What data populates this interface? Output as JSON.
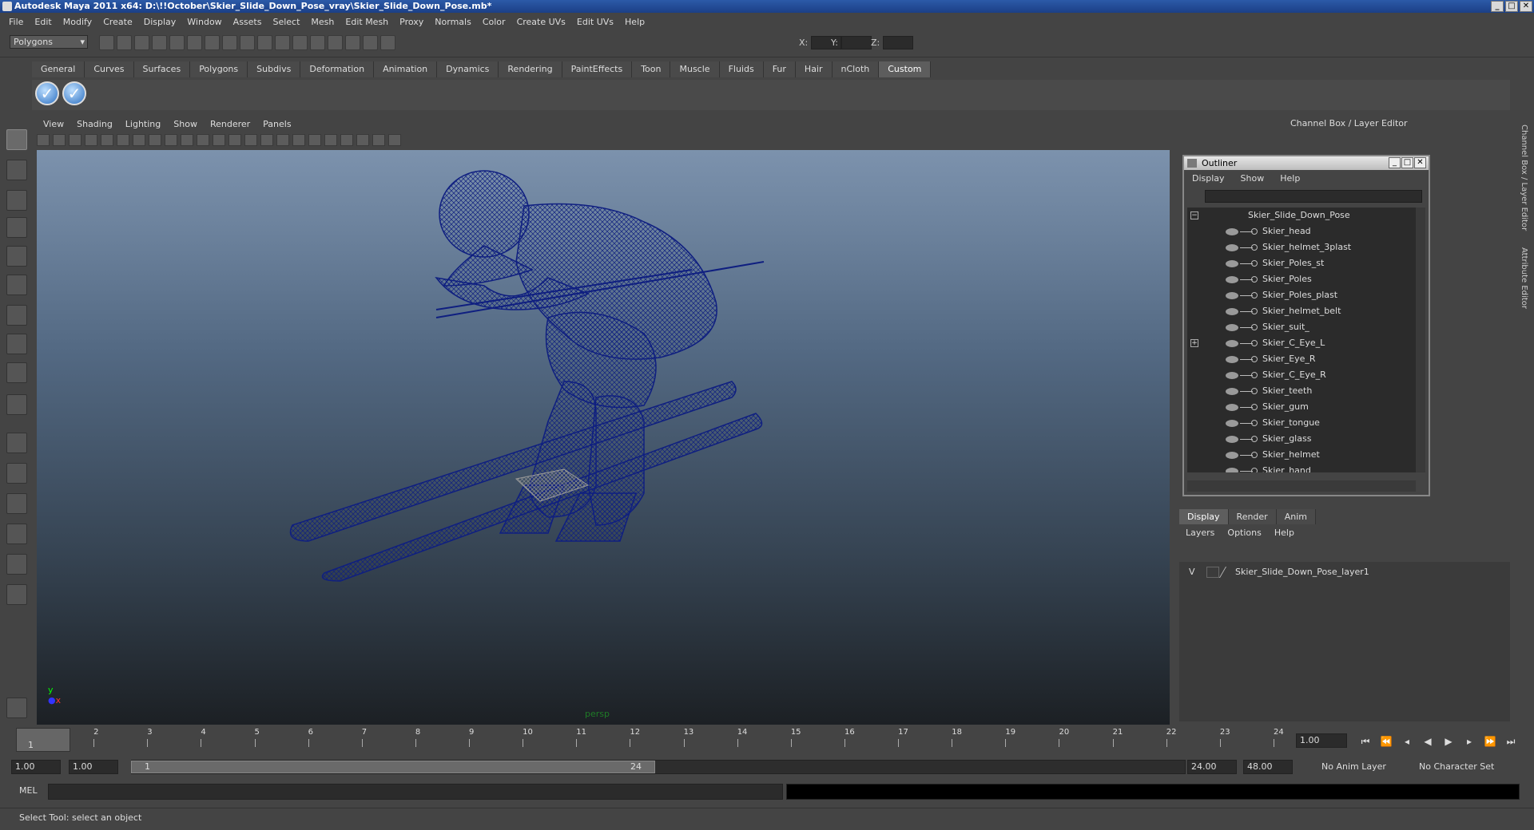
{
  "window": {
    "title": "Autodesk Maya 2011 x64: D:\\!!October\\Skier_Slide_Down_Pose_vray\\Skier_Slide_Down_Pose.mb*"
  },
  "menus": [
    "File",
    "Edit",
    "Modify",
    "Create",
    "Display",
    "Window",
    "Assets",
    "Select",
    "Mesh",
    "Edit Mesh",
    "Proxy",
    "Normals",
    "Color",
    "Create UVs",
    "Edit UVs",
    "Help"
  ],
  "status": {
    "mode": "Polygons",
    "x_label": "X:",
    "y_label": "Y:",
    "z_label": "Z:"
  },
  "shelf": {
    "tabs": [
      "General",
      "Curves",
      "Surfaces",
      "Polygons",
      "Subdivs",
      "Deformation",
      "Animation",
      "Dynamics",
      "Rendering",
      "PaintEffects",
      "Toon",
      "Muscle",
      "Fluids",
      "Fur",
      "Hair",
      "nCloth",
      "Custom"
    ],
    "active_tab": "Custom"
  },
  "viewport": {
    "menu": [
      "View",
      "Shading",
      "Lighting",
      "Show",
      "Renderer",
      "Panels"
    ],
    "camera": "persp",
    "axis_y": "y",
    "axis_x": "x",
    "wire_color": "#101f7a"
  },
  "channel_box": {
    "title": "Channel Box / Layer Editor"
  },
  "outliner": {
    "title": "Outliner",
    "menu": [
      "Display",
      "Show",
      "Help"
    ],
    "root": "Skier_Slide_Down_Pose",
    "items": [
      "Skier_head",
      "Skier_helmet_3plast",
      "Skier_Poles_st",
      "Skier_Poles",
      "Skier_Poles_plast",
      "Skier_helmet_belt",
      "Skier_suit_",
      "Skier_C_Eye_L",
      "Skier_Eye_R",
      "Skier_C_Eye_R",
      "Skier_teeth",
      "Skier_gum",
      "Skier_tongue",
      "Skier_glass",
      "Skier_helmet",
      "Skier_hand"
    ]
  },
  "layers": {
    "tabs": [
      "Display",
      "Render",
      "Anim"
    ],
    "active_tab": "Display",
    "menu": [
      "Layers",
      "Options",
      "Help"
    ],
    "visible_flag": "V",
    "layer_name": "Skier_Slide_Down_Pose_layer1"
  },
  "side_tabs": [
    "Channel Box / Layer Editor",
    "Attribute Editor"
  ],
  "timeline": {
    "ticks": [
      "1",
      "2",
      "3",
      "4",
      "5",
      "6",
      "7",
      "8",
      "9",
      "10",
      "11",
      "12",
      "13",
      "14",
      "15",
      "16",
      "17",
      "18",
      "19",
      "20",
      "21",
      "22",
      "23",
      "24"
    ],
    "current_frame": "1.00",
    "current_marker": "1"
  },
  "range": {
    "start": "1.00",
    "start2": "1.00",
    "inner_start": "1",
    "inner_end": "24",
    "end": "24.00",
    "end2": "48.00",
    "anim_layer": "No Anim Layer",
    "char_set": "No Character Set"
  },
  "command": {
    "label": "MEL"
  },
  "help": {
    "text": "Select Tool: select an object"
  }
}
